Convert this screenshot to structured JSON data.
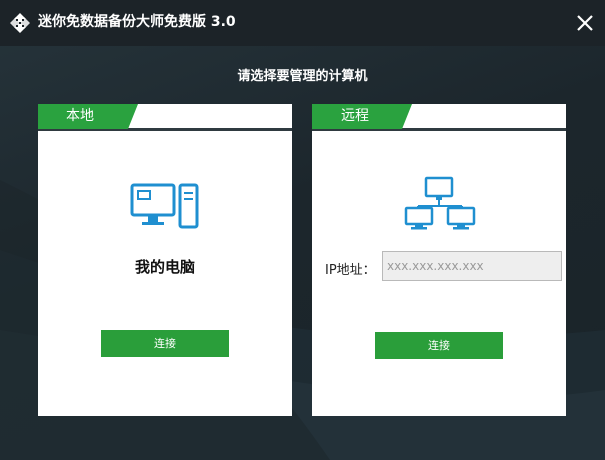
{
  "window": {
    "title": "迷你免数据备份大师免费版 3.0",
    "close_icon": "close-icon",
    "logo_icon": "sync-arrows-logo-icon"
  },
  "main": {
    "heading": "请选择要管理的计算机"
  },
  "local": {
    "tab_label": "本地",
    "icon": "desktop-computer-icon",
    "computer_label": "我的电脑",
    "connect_label": "连接"
  },
  "remote": {
    "tab_label": "远程",
    "icon": "network-computers-icon",
    "ip_label": "IP地址：",
    "ip_placeholder": "xxx.xxx.xxx.xxx",
    "connect_label": "连接"
  },
  "colors": {
    "accent_green": "#2aa23f",
    "icon_blue": "#1f8fd0",
    "background": "#1f2a31"
  }
}
